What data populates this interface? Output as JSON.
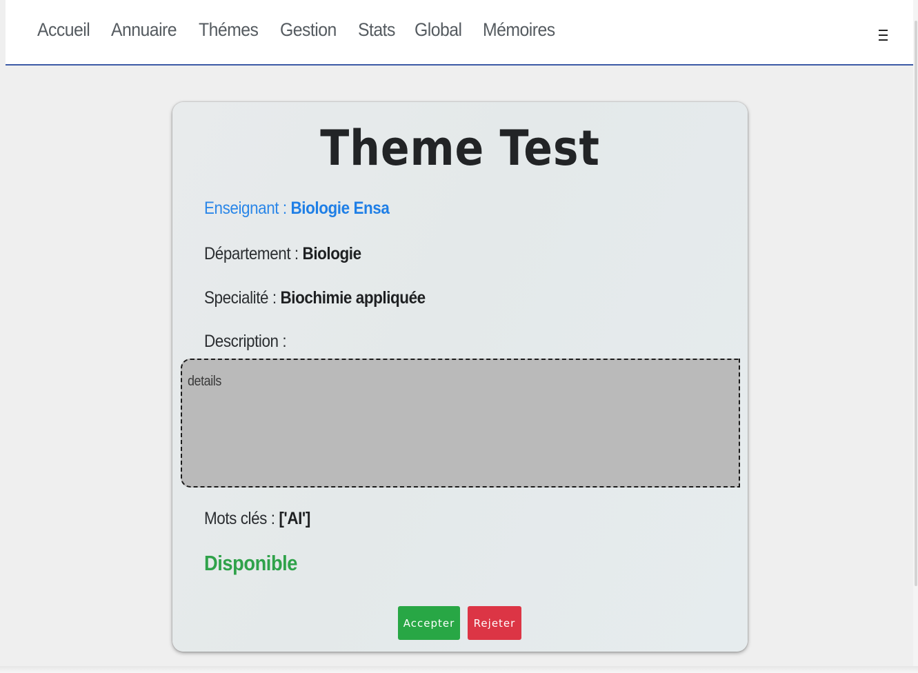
{
  "nav": {
    "links": [
      "Accueil",
      "Annuaire",
      "Thémes",
      "Gestion",
      "Stats",
      "Global",
      "Mémoires"
    ]
  },
  "theme": {
    "title": "Theme Test",
    "teacher_label": "Enseignant : ",
    "teacher_value": "Biologie Ensa",
    "department_label": "Département : ",
    "department_value": "Biologie",
    "specialty_label": "Specialité : ",
    "specialty_value": "Biochimie appliquée",
    "description_label": "Description :",
    "description_value": "details",
    "keywords_label": "Mots clés : ",
    "keywords_value": "['AI']",
    "status": "Disponible"
  },
  "actions": {
    "accept_label": "Accepter",
    "reject_label": "Rejeter"
  },
  "colors": {
    "accent_blue": "#1f7fe6",
    "status_green": "#2fa24a",
    "accept_green": "#28a745",
    "reject_red": "#dc3545",
    "nav_border": "#3b59a6"
  },
  "icons": {
    "menu": "hamburger-menu-icon"
  }
}
